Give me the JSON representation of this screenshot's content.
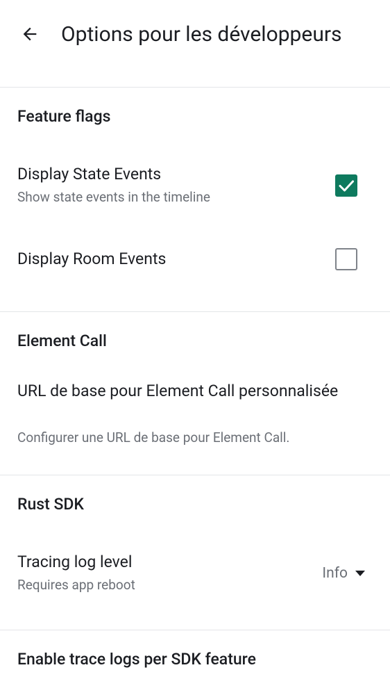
{
  "header": {
    "title": "Options pour les développeurs",
    "back_icon": "arrow-back-icon"
  },
  "colors": {
    "accent": "#0e7a5e",
    "text_primary": "#1b1d22",
    "text_secondary": "#6b6f76",
    "divider": "#e3e5e8"
  },
  "sections": {
    "feature_flags": {
      "title": "Feature flags",
      "display_state_events": {
        "label": "Display State Events",
        "description": "Show state events in the timeline",
        "checked": true
      },
      "display_room_events": {
        "label": "Display Room Events",
        "checked": false
      }
    },
    "element_call": {
      "title": "Element Call",
      "base_url": {
        "label": "URL de base pour Element Call personnalisée",
        "description": "Configurer une URL de base pour Element Call."
      }
    },
    "rust_sdk": {
      "title": "Rust SDK",
      "tracing_log_level": {
        "label": "Tracing log level",
        "description": "Requires app reboot",
        "value": "Info"
      }
    },
    "trace_logs": {
      "title": "Enable trace logs per SDK feature"
    }
  }
}
